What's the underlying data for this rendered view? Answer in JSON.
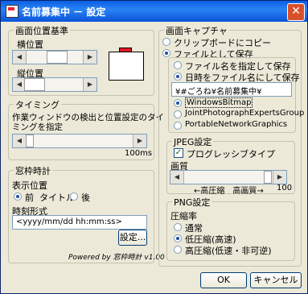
{
  "window": {
    "title": "名前募集中 － 設定",
    "close": "✕"
  },
  "position": {
    "title": "画面位置基準",
    "horizontal": {
      "label": "横位置",
      "left": "◀",
      "right": "▶"
    },
    "vertical": {
      "label": "縦位置",
      "left": "◀",
      "right": "▶"
    }
  },
  "timing": {
    "title": "タイミング",
    "desc1": "作業ウィンドウの検出と位置設定のタイ",
    "desc2": "ミングを指定",
    "left": "◀",
    "right": "▶",
    "value": "100ms"
  },
  "clock": {
    "title": "窓枠時計",
    "display_label": "表示位置",
    "front": "前",
    "title_word": "タイトル",
    "back": "後",
    "format_label": "時刻形式",
    "format_value": "<yyyy/mm/dd hh:mm:ss>",
    "settings_button": "設定...",
    "powered": "Powered by 窓枠時計 v1.00"
  },
  "capture": {
    "title": "画面キャプチャ",
    "clipboard": "クリップボードにコピー",
    "save_file": "ファイルとして保存",
    "specify_name": "ファイル名を指定して保存",
    "datetime_name": "日時をファイル名にして保存",
    "path": "¥#ごろね¥名前募集中¥",
    "formats": [
      "WindowsBitmap",
      "JointPhotographExpertsGroup",
      "PortableNetworkGraphics"
    ]
  },
  "jpeg": {
    "title": "JPEG設定",
    "progressive": "プログレッシブタイプ",
    "check_mark": "✓",
    "quality_label": "画質",
    "left": "◀",
    "right": "▶",
    "scale": "←高圧縮　高画質→",
    "value": "100"
  },
  "png": {
    "title": "PNG設定",
    "ratio_label": "圧縮率",
    "options": [
      "通常",
      "低圧縮(高速)",
      "高圧縮(低速・非可逆)"
    ]
  },
  "buttons": {
    "ok": "OK",
    "cancel": "キャンセル"
  }
}
